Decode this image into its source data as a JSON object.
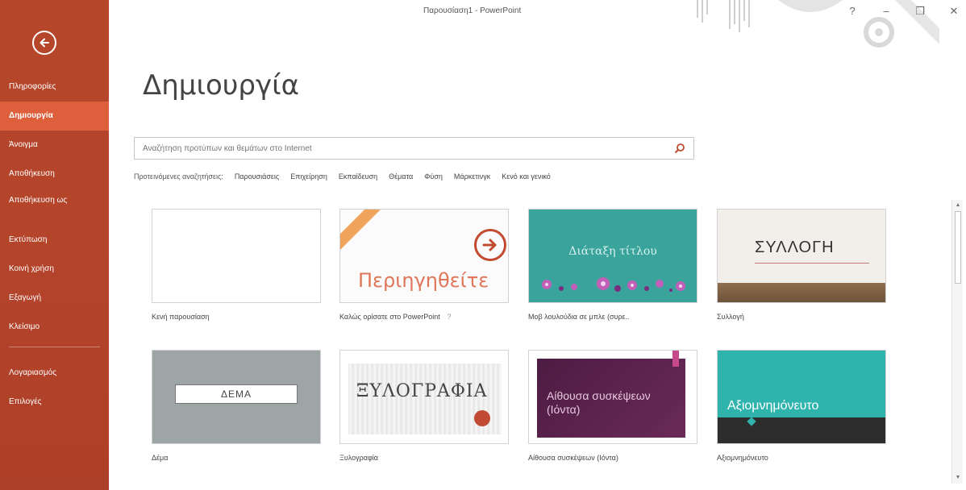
{
  "window": {
    "title": "Παρουσίαση1 - PowerPoint",
    "controls": {
      "help": "?",
      "minimize": "–",
      "restore": "❐",
      "close": "✕"
    }
  },
  "sidebar": {
    "back_icon": "back-arrow-icon",
    "items": [
      {
        "label": "Πληροφορίες",
        "active": false
      },
      {
        "label": "Δημιουργία",
        "active": true
      },
      {
        "label": "Άνοιγμα",
        "active": false
      },
      {
        "label": "Αποθήκευση",
        "active": false
      },
      {
        "label": "Αποθήκευση ως",
        "active": false
      },
      {
        "label": "Εκτύπωση",
        "active": false
      },
      {
        "label": "Κοινή χρήση",
        "active": false
      },
      {
        "label": "Εξαγωγή",
        "active": false
      },
      {
        "label": "Κλείσιμο",
        "active": false
      }
    ],
    "bottom_items": [
      {
        "label": "Λογαριασμός"
      },
      {
        "label": "Επιλογές"
      }
    ]
  },
  "main": {
    "page_title": "Δημιουργία",
    "search": {
      "placeholder": "Αναζήτηση προτύπων και θεμάτων στο Internet",
      "value": ""
    },
    "suggestions": {
      "label": "Προτεινόμενες αναζητήσεις:",
      "items": [
        "Παρουσιάσεις",
        "Επιχείρηση",
        "Εκπαίδευση",
        "Θέματα",
        "Φύση",
        "Μάρκετινγκ",
        "Κενό και γενικό"
      ]
    },
    "templates": [
      {
        "caption": "Κενή παρουσίαση"
      },
      {
        "caption": "Καλώς ορίσατε στο PowerPoint",
        "thumb_text": "Περιηγηθείτε",
        "pin": "?"
      },
      {
        "caption": "Μοβ λουλούδια σε μπλε (συρε..",
        "thumb_text": "Διάταξη τίτλου"
      },
      {
        "caption": "Συλλογή",
        "thumb_text": "ΣΥΛΛΟΓΗ"
      },
      {
        "caption": "Δέμα",
        "thumb_text": "ΔΕΜΑ"
      },
      {
        "caption": "Ξυλογραφία",
        "thumb_text": "ΞΥΛΟΓΡΑΦΙΑ"
      },
      {
        "caption": "Αίθουσα συσκέψεων (Ιόντα)",
        "thumb_text": "Αίθουσα συσκέψεων (Ιόντα)"
      },
      {
        "caption": "Αξιομνημόνευτο",
        "thumb_text": "Αξιομνημόνευτο"
      }
    ]
  },
  "colors": {
    "sidebar": "#b7472a",
    "sidebar_active": "#de5f3c",
    "accent": "#c14a2e"
  }
}
